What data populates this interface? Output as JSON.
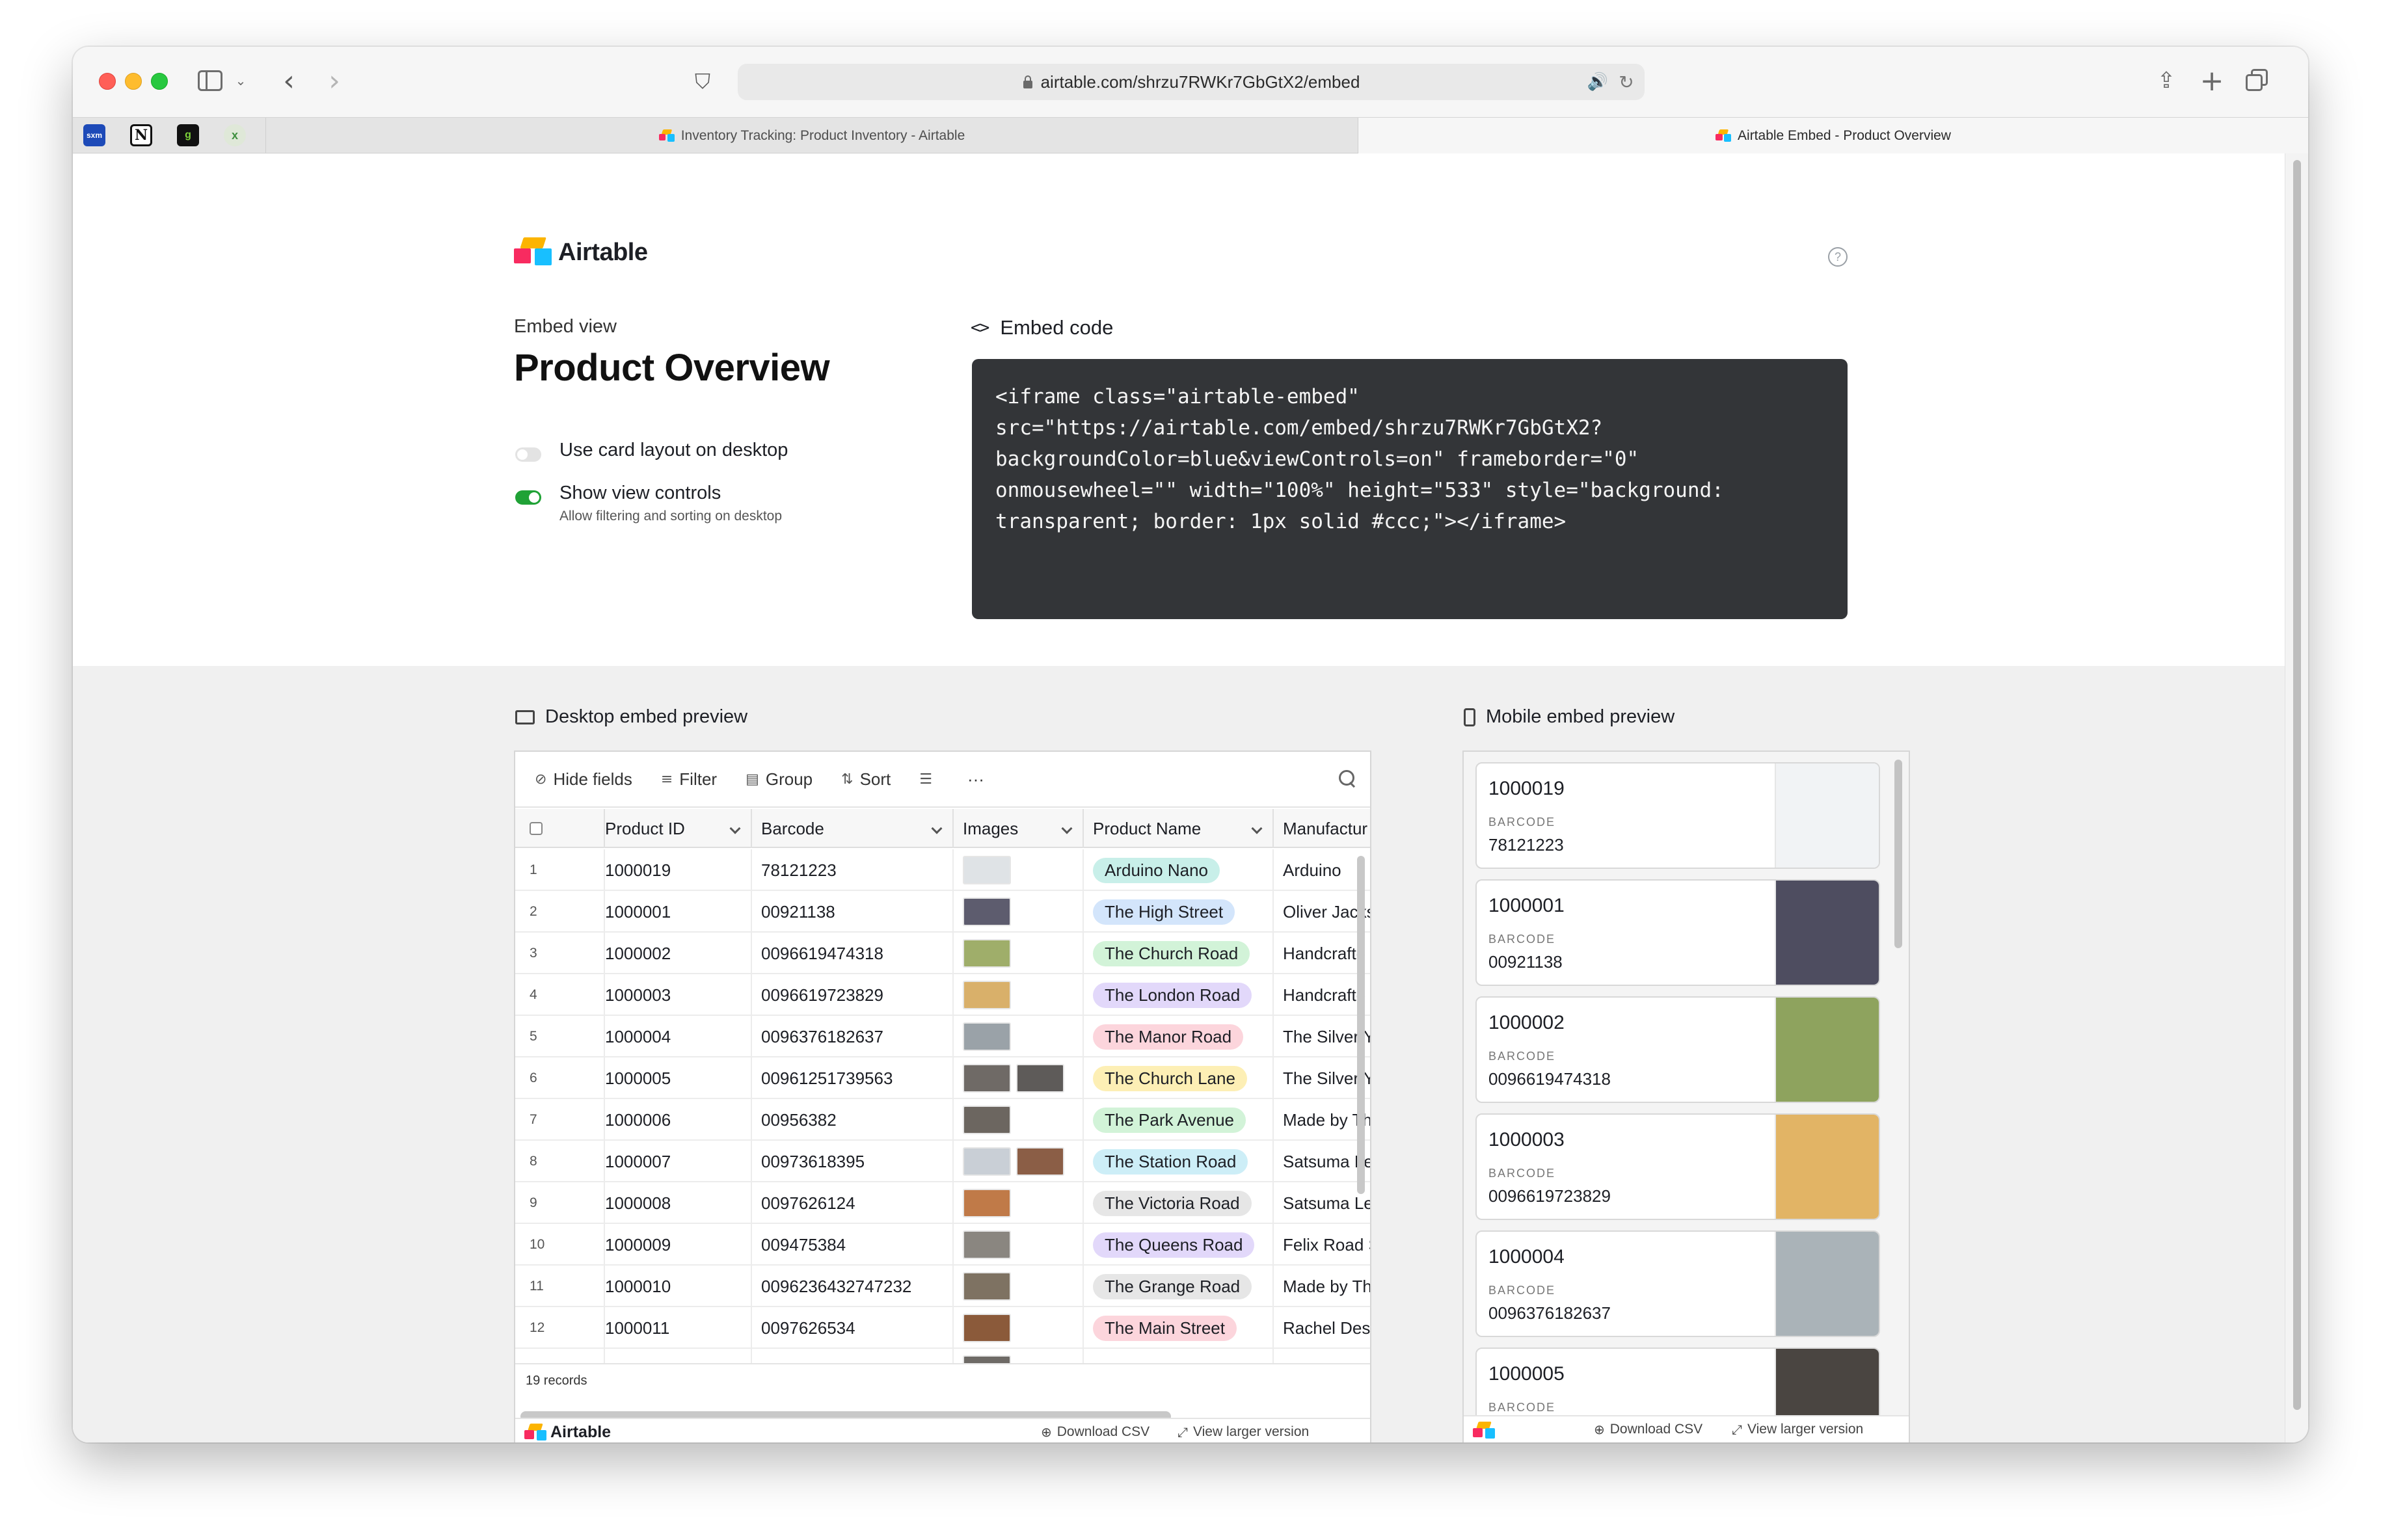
{
  "browser": {
    "url": "airtable.com/shrzu7RWKr7GbGtX2/embed",
    "icons": [
      "sidebar-icon",
      "chevron-down-icon",
      "back-icon",
      "forward-icon",
      "shield-icon",
      "lock-icon",
      "speaker-icon",
      "reload-icon",
      "share-icon",
      "new-tab-icon",
      "tab-overview-icon"
    ],
    "favorites": [
      {
        "name": "siriusxm",
        "glyph": "sxm"
      },
      {
        "name": "notion",
        "glyph": "N"
      },
      {
        "name": "goodreads",
        "glyph": "g"
      },
      {
        "name": "xbox",
        "glyph": "x"
      }
    ],
    "tabs": [
      {
        "title": "Inventory Tracking: Product Inventory - Airtable",
        "active": false
      },
      {
        "title": "Airtable Embed - Product Overview",
        "active": true
      }
    ]
  },
  "page": {
    "brand": "Airtable",
    "embed_view_label": "Embed view",
    "title": "Product Overview",
    "options": [
      {
        "label": "Use card layout on desktop",
        "enabled": false,
        "sublabel": ""
      },
      {
        "label": "Show view controls",
        "enabled": true,
        "sublabel": "Allow filtering and sorting on desktop"
      }
    ],
    "embed_code_heading": "Embed code",
    "embed_code": "<iframe class=\"airtable-embed\"\nsrc=\"https://airtable.com/embed/shrzu7RWKr7GbGtX2?\nbackgroundColor=blue&viewControls=on\" frameborder=\"0\"\nonmousewheel=\"\" width=\"100%\" height=\"533\" style=\"background:\ntransparent; border: 1px solid #ccc;\"></iframe>",
    "accent_colors": {
      "toggle_on": "#20a236",
      "code_bg": "#333538",
      "logo_yellow": "#fcb400",
      "logo_blue": "#18bfff",
      "logo_red": "#f82b60"
    }
  },
  "desktop_preview": {
    "heading": "Desktop embed preview",
    "toolbar": {
      "hide_fields": "Hide fields",
      "filter": "Filter",
      "group": "Group",
      "sort": "Sort",
      "more": "···"
    },
    "columns": [
      "Product ID",
      "Barcode",
      "Images",
      "Product Name",
      "Manufactur"
    ],
    "rows": [
      {
        "n": "1",
        "id": "1000019",
        "barcode": "78121223",
        "images": [
          "#dfe3e6"
        ],
        "name": "Arduino Nano",
        "pill": "#c8efe9",
        "mfr": "Arduino"
      },
      {
        "n": "2",
        "id": "1000001",
        "barcode": "00921138",
        "images": [
          "#5d5c6e"
        ],
        "name": "The High Street",
        "pill": "#d3e5fb",
        "mfr": "Oliver Jacks"
      },
      {
        "n": "3",
        "id": "1000002",
        "barcode": "0096619474318",
        "images": [
          "#9fae6a"
        ],
        "name": "The Church Road",
        "pill": "#d2f3d8",
        "mfr": "Handcrafte"
      },
      {
        "n": "4",
        "id": "1000003",
        "barcode": "0096619723829",
        "images": [
          "#d9b06a"
        ],
        "name": "The London Road",
        "pill": "#e2d8fa",
        "mfr": "Handcrafte"
      },
      {
        "n": "5",
        "id": "1000004",
        "barcode": "0096376182637",
        "images": [
          "#9aa2a8"
        ],
        "name": "The Manor Road",
        "pill": "#fcd5dc",
        "mfr": "The Silver Y"
      },
      {
        "n": "6",
        "id": "1000005",
        "barcode": "00961251739563",
        "images": [
          "#6f6a66",
          "#5e5b59"
        ],
        "name": "The Church Lane",
        "pill": "#fdefb5",
        "mfr": "The Silver Y"
      },
      {
        "n": "7",
        "id": "1000006",
        "barcode": "00956382",
        "images": [
          "#6c6660"
        ],
        "name": "The Park Avenue",
        "pill": "#d2f3d8",
        "mfr": "Made by Th"
      },
      {
        "n": "8",
        "id": "1000007",
        "barcode": "00973618395",
        "images": [
          "#c9cfd6",
          "#8b5e46"
        ],
        "name": "The Station Road",
        "pill": "#cdeef7",
        "mfr": "Satsuma Le"
      },
      {
        "n": "9",
        "id": "1000008",
        "barcode": "0097626124",
        "images": [
          "#c07a48"
        ],
        "name": "The Victoria Road",
        "pill": "#e6e6e6",
        "mfr": "Satsuma Le"
      },
      {
        "n": "10",
        "id": "1000009",
        "barcode": "009475384",
        "images": [
          "#8a8680"
        ],
        "name": "The Queens Road",
        "pill": "#e2d8fa",
        "mfr": "Felix Road S"
      },
      {
        "n": "11",
        "id": "1000010",
        "barcode": "0096236432747232",
        "images": [
          "#7e7262"
        ],
        "name": "The Grange Road",
        "pill": "#e6e6e6",
        "mfr": "Made by Th"
      },
      {
        "n": "12",
        "id": "1000011",
        "barcode": "0097626534",
        "images": [
          "#8b5a3a"
        ],
        "name": "The Main Street",
        "pill": "#fcd5dc",
        "mfr": "Rachel Des"
      },
      {
        "n": "13",
        "id": "",
        "barcode": "",
        "images": [
          "#6e6a66"
        ],
        "name": "",
        "pill": "#d3e5fb",
        "mfr": ""
      }
    ],
    "record_count": "19 records",
    "footer": {
      "brand": "Airtable",
      "download": "Download CSV",
      "larger": "View larger version"
    }
  },
  "mobile_preview": {
    "heading": "Mobile embed preview",
    "barcode_label": "BARCODE",
    "cards": [
      {
        "id": "1000019",
        "barcode": "78121223",
        "img": "#f1f3f5"
      },
      {
        "id": "1000001",
        "barcode": "00921138",
        "img": "#4e4d60"
      },
      {
        "id": "1000002",
        "barcode": "0096619474318",
        "img": "#8ea35e"
      },
      {
        "id": "1000003",
        "barcode": "0096619723829",
        "img": "#e2b465"
      },
      {
        "id": "1000004",
        "barcode": "0096376182637",
        "img": "#aab3b8"
      },
      {
        "id": "1000005",
        "barcode": "",
        "img": "#4a4541"
      }
    ],
    "footer": {
      "download": "Download CSV",
      "larger": "View larger version"
    }
  }
}
